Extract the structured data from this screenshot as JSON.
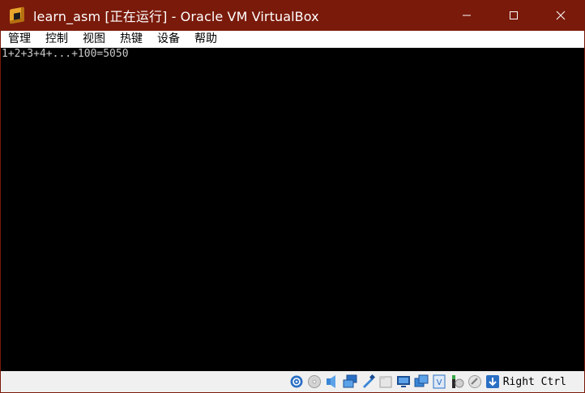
{
  "window": {
    "title": "learn_asm [正在运行] - Oracle VM VirtualBox"
  },
  "menu": {
    "items": [
      {
        "label": "管理"
      },
      {
        "label": "控制"
      },
      {
        "label": "视图"
      },
      {
        "label": "热键"
      },
      {
        "label": "设备"
      },
      {
        "label": "帮助"
      }
    ]
  },
  "console": {
    "output": "1+2+3+4+...+100=5050"
  },
  "statusbar": {
    "host_key": "Right Ctrl",
    "icons": [
      "hard-disk-icon",
      "optical-drive-icon",
      "audio-icon",
      "network-icon",
      "usb-icon",
      "shared-folders-icon",
      "display-icon",
      "recording-icon",
      "virtualization-icon",
      "mouse-integration-icon",
      "host-key-arrow-icon"
    ]
  },
  "colors": {
    "titlebar": "#7a1a0a",
    "console_bg": "#000000",
    "console_text": "#c8c8c8",
    "statusbar_bg": "#f0f0f0"
  }
}
